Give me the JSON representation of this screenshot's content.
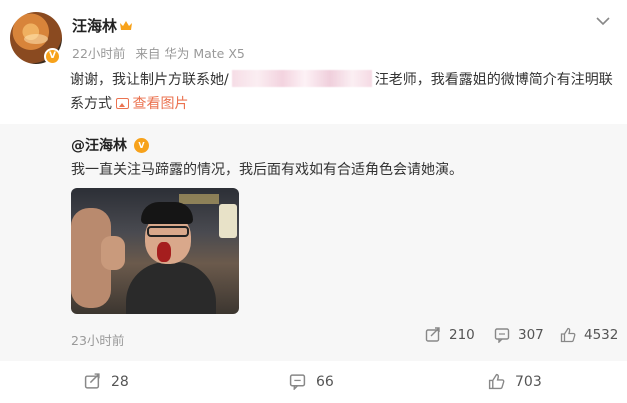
{
  "post": {
    "username": "汪海林",
    "time": "22小时前",
    "source": "来自 华为 Mate X5",
    "text_part1": "谢谢，我让制片方联系她/",
    "text_part2": "汪老师，我看露姐的微博简介有注明联系方式",
    "view_pic_label": "查看图片",
    "verified_mark": "V"
  },
  "repost": {
    "username": "@汪海林",
    "text": "我一直关注马蹄露的情况，我后面有戏如有合适角色会请她演。",
    "time": "23小时前",
    "reposts": "210",
    "comments": "307",
    "likes": "4532",
    "verified_mark": "V"
  },
  "actions": {
    "reposts": "28",
    "comments": "66",
    "likes": "703"
  },
  "colors": {
    "link_orange": "#eb7350",
    "badge_gold": "#f7a21b",
    "repost_bg": "#f7f7f7"
  }
}
